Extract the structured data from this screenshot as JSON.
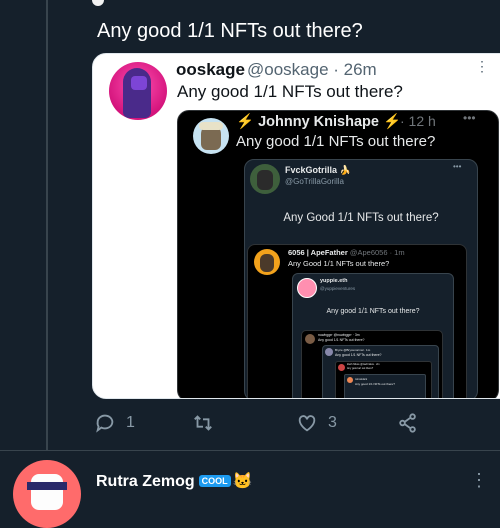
{
  "main_tweet": {
    "text": "Any good 1/1 NFTs out there?"
  },
  "quote_ooskage": {
    "name": "ooskage",
    "meta": "@ooskage · 26m",
    "text": "Any good 1/1 NFTs out there?"
  },
  "quote_johnny": {
    "bolt_left": "⚡",
    "name": "Johnny Knishape",
    "bolt_right": "⚡",
    "meta": "· 12 h",
    "text": "Any good 1/1 NFTs out there?"
  },
  "quote_gotrilla": {
    "name": "FvckGotrilla 🍌",
    "handle": "@GoTrillaGorilla",
    "text": "Any Good 1/1 NFTs out there?"
  },
  "quote_apefather": {
    "name": "6056 | ApeFather",
    "meta": "@Ape6056 · 1m",
    "text": "Any Good 1/1 NFTs out there?"
  },
  "quote_yuppie": {
    "name": "yuppie.eth",
    "handle": "@yuppieventures",
    "text": "Any good 1/1 NFTs out there?"
  },
  "quote_tiny1": {
    "line1": "nuwbggrr @nuwbggrr · 3m",
    "line2": "Any good 1/1 NFTs out there?"
  },
  "quote_tiny2": {
    "line1": "Bryce @Brycenormal · 1m",
    "line2": "Any good 1/1 NFTs out there?"
  },
  "quote_tiny3": {
    "line1": "Zach Nikos @zachnikos · 2m",
    "line2": "Any good art out there?"
  },
  "quote_tiny4": {
    "line1": "minoxidant",
    "line2": "Any good 1/1 NFTs out there?"
  },
  "actions": {
    "reply_count": "1",
    "retweet_count": "",
    "like_count": "3"
  },
  "next_tweet": {
    "name": "Rutra Zemog",
    "badge": "COOL",
    "emoji": "🐱"
  },
  "icons": [
    "reply-icon",
    "retweet-icon",
    "like-icon",
    "share-icon",
    "more-icon"
  ],
  "colors": {
    "background": "#15202b",
    "card_white": "#ffffff",
    "card_dark": "#000000",
    "muted": "#8899a6",
    "bolt": "#fbd33f"
  }
}
